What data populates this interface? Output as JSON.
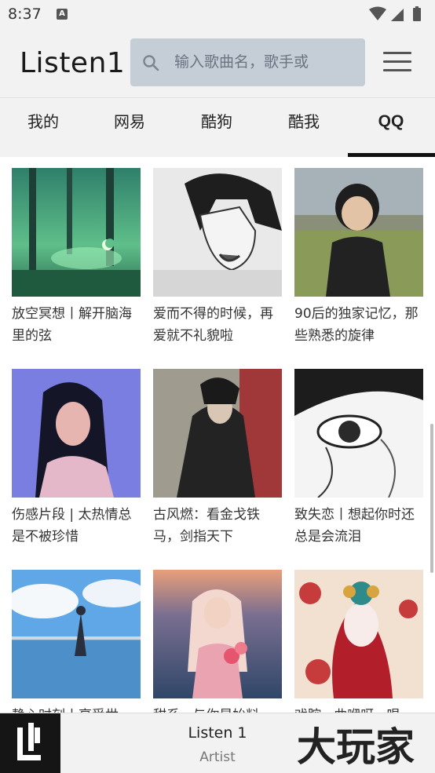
{
  "status_bar": {
    "time": "8:37",
    "notification_letter": "A"
  },
  "header": {
    "app_title": "Listen1",
    "search_placeholder": "输入歌曲名，歌手或"
  },
  "tabs": [
    {
      "label": "我的"
    },
    {
      "label": "网易"
    },
    {
      "label": "酷狗"
    },
    {
      "label": "酷我"
    },
    {
      "label": "QQ",
      "active": true
    }
  ],
  "playlists": [
    {
      "title": "放空冥想丨解开脑海里的弦"
    },
    {
      "title": "爱而不得的时候，再爱就不礼貌啦"
    },
    {
      "title": "90后的独家记忆，那些熟悉的旋律"
    },
    {
      "title": "伤感片段 | 太热情总是不被珍惜"
    },
    {
      "title": "古风燃：看金戈铁马，剑指天下"
    },
    {
      "title": "致失恋丨想起你时还总是会流泪"
    },
    {
      "title": "静心时刻丨享受世"
    },
    {
      "title": "甜系 · 与你是始料"
    },
    {
      "title": "戏腔 · 曲咿呀 · 唱"
    }
  ],
  "player": {
    "song": "Listen 1",
    "artist": "Artist"
  },
  "watermark": {
    "text": "大玩家"
  }
}
